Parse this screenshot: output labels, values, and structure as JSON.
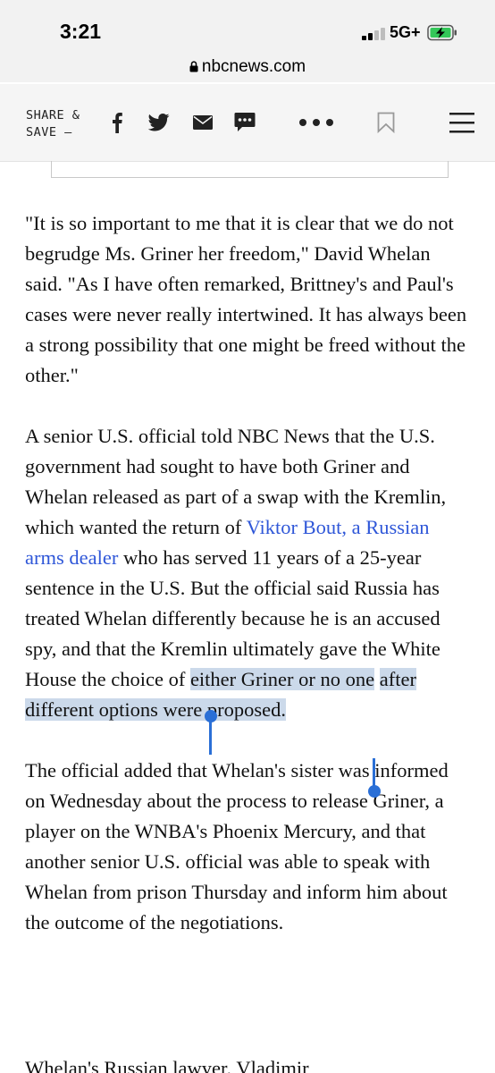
{
  "status_bar": {
    "time": "3:21",
    "network": "5G+",
    "battery_charging": true,
    "battery_color": "#34c759"
  },
  "browser": {
    "url": "nbcnews.com",
    "lock_icon": "lock-icon"
  },
  "share_bar": {
    "label_line1": "SHARE &",
    "label_line2": "SAVE —",
    "icons": [
      "facebook-icon",
      "twitter-icon",
      "email-icon",
      "sms-icon",
      "more-icon",
      "bookmark-icon",
      "hamburger-menu-icon"
    ]
  },
  "article": {
    "p1": "\"It is so important to me that it is clear that we do not begrudge Ms. Griner her freedom,\" David Whelan said. \"As I have often remarked, Brittney's and Paul's cases were never really intertwined. It has always been a strong possibility that one might be freed without the other.\"",
    "p2_before_link": "A senior U.S. official told NBC News that the U.S. government had sought to have both Griner and Whelan released as part of a swap with the Kremlin, which wanted the return of ",
    "p2_link": "Viktor Bout, a Russian arms dealer",
    "p2_after_link": " who has served 11 years of a 25-year sentence in the U.S. But the official said Russia has treated Whelan differently because he is an accused spy, and that the Kremlin ultimately gave the White House the choice of ",
    "p2_selected_1": "either Griner or no one",
    "p2_selected_2": "after different options were proposed.",
    "p3": "The official added that Whelan's sister was informed on Wednesday about the process to release Griner, a player on the WNBA's Phoenix Mercury, and that another senior U.S. official was able to speak with Whelan from prison Thursday and inform him about the outcome of the negotiations.",
    "p4_cutoff": "Whelan's Russian lawyer, Vladimir"
  },
  "colors": {
    "link": "#2f57d8",
    "selection": "#cbd9ea",
    "selection_handle": "#2a6fd6"
  }
}
